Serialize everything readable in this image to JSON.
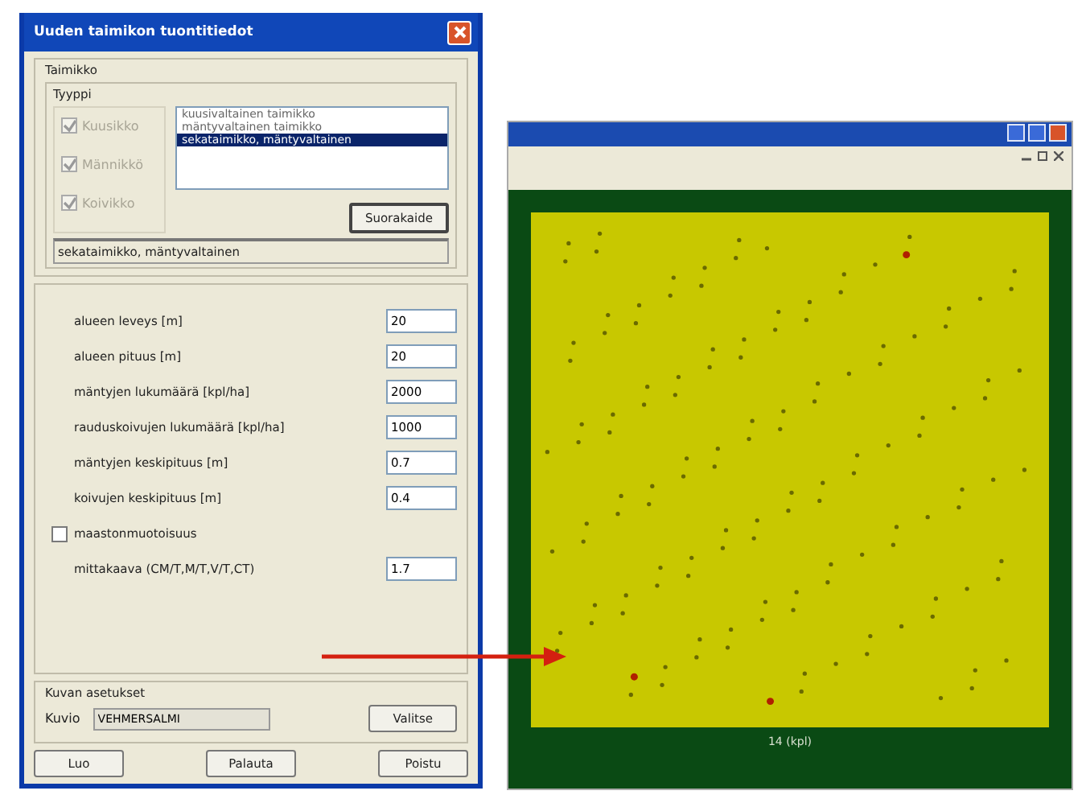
{
  "dialog": {
    "title": "Uuden taimikon tuontitiedot",
    "group_title": "Taimikko",
    "type_title": "Tyyppi",
    "species": [
      {
        "label": "Kuusikko",
        "checked": true,
        "disabled": true
      },
      {
        "label": "Männikkö",
        "checked": true,
        "disabled": true
      },
      {
        "label": "Koivikko",
        "checked": true,
        "disabled": true
      }
    ],
    "stand_list": [
      {
        "label": "kuusivaltainen taimikko",
        "selected": false
      },
      {
        "label": "mäntyvaltainen taimikko",
        "selected": false
      },
      {
        "label": "sekataimikko, mäntyvaltainen",
        "selected": true
      }
    ],
    "list_button": "Suorakaide",
    "status": "sekataimikko, mäntyvaltainen",
    "fields": [
      {
        "kind": "input",
        "label": "alueen leveys [m]",
        "value": "20"
      },
      {
        "kind": "input",
        "label": "alueen pituus [m]",
        "value": "20"
      },
      {
        "kind": "input",
        "label": "mäntyjen lukumäärä [kpl/ha]",
        "value": "2000"
      },
      {
        "kind": "input",
        "label": "rauduskoivujen lukumäärä [kpl/ha]",
        "value": "1000"
      },
      {
        "kind": "input",
        "label": "mäntyjen keskipituus [m]",
        "value": "0.7"
      },
      {
        "kind": "input",
        "label": "koivujen keskipituus [m]",
        "value": "0.4"
      },
      {
        "kind": "checkbox",
        "label": "maastonmuotoisuus",
        "checked": false
      },
      {
        "kind": "input",
        "label": "mittakaava (CM/T,M/T,V/T,CT)",
        "value": "1.7"
      }
    ],
    "image_group": "Kuvan asetukset",
    "image_label": "Kuvio",
    "image_value": "VEHMERSALMI",
    "image_button": "Valitse",
    "buttons": [
      "Luo",
      "Palauta",
      "Poistu"
    ]
  },
  "viewer": {
    "caption": "14 (kpl)"
  }
}
